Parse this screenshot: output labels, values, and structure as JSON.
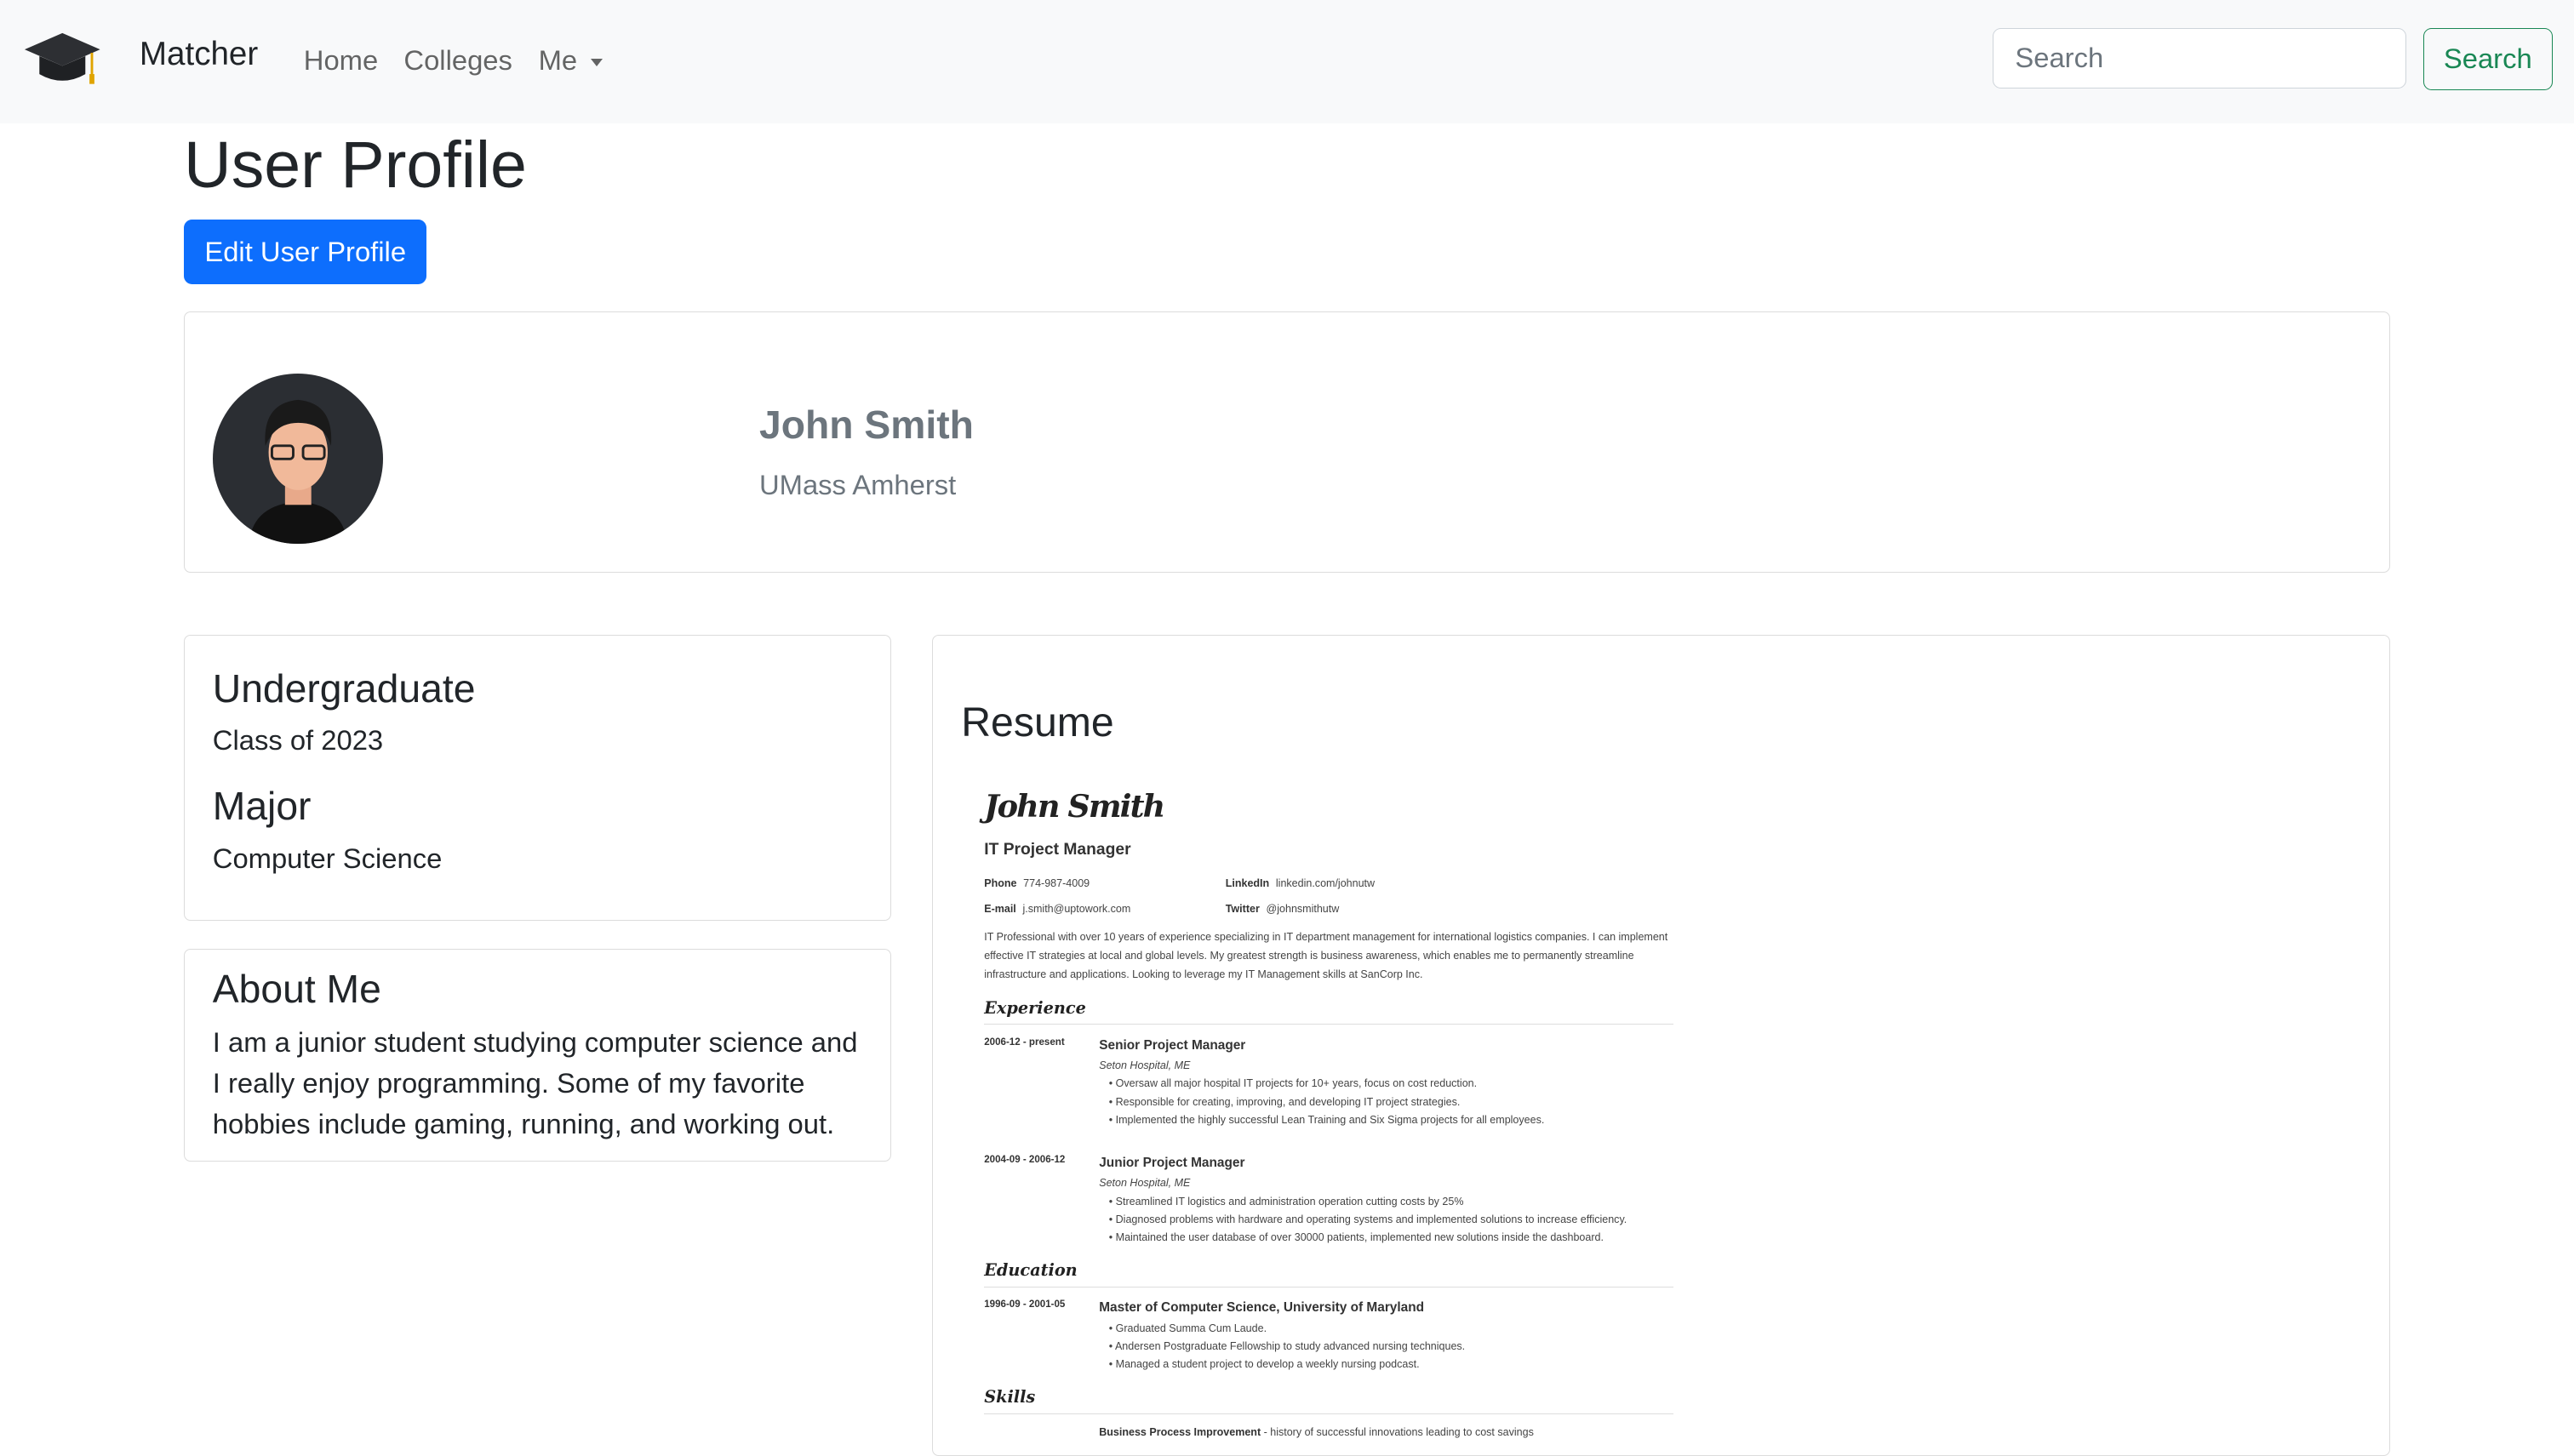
{
  "nav": {
    "brand": "Matcher",
    "links": [
      "Home",
      "Colleges",
      "Me"
    ],
    "search_placeholder": "Search",
    "search_button": "Search"
  },
  "page": {
    "title": "User Profile",
    "edit_button": "Edit User Profile"
  },
  "profile": {
    "name": "John Smith",
    "school": "UMass Amherst"
  },
  "academics": {
    "level": "Undergraduate",
    "class": "Class of 2023",
    "major_label": "Major",
    "major": "Computer Science"
  },
  "about": {
    "title": "About Me",
    "text": "I am a junior student studying computer science and I really enjoy programming. Some of my favorite hobbies include gaming, running, and working out."
  },
  "resume": {
    "heading": "Resume",
    "name": "John Smith",
    "title": "IT Project Manager",
    "phone_label": "Phone",
    "phone": "774-987-4009",
    "linkedin_label": "LinkedIn",
    "linkedin": "linkedin.com/johnutw",
    "email_label": "E-mail",
    "email": "j.smith@uptowork.com",
    "twitter_label": "Twitter",
    "twitter": "@johnsmithutw",
    "summary": "IT Professional with over 10 years of experience specializing in IT department management for international logistics companies. I can implement effective IT strategies at local and global levels. My greatest strength is business awareness, which enables me to permanently streamline infrastructure and applications. Looking to leverage my IT Management skills at SanCorp Inc.",
    "experience_label": "Experience",
    "jobs": [
      {
        "date": "2006-12 - present",
        "title": "Senior Project Manager",
        "place": "Seton Hospital, ME",
        "bullets": [
          "Oversaw all major hospital IT projects for 10+ years, focus on cost reduction.",
          "Responsible for creating, improving, and developing IT project strategies.",
          "Implemented the highly successful Lean Training and Six Sigma projects for all employees."
        ]
      },
      {
        "date": "2004-09 - 2006-12",
        "title": "Junior Project Manager",
        "place": "Seton Hospital, ME",
        "bullets": [
          "Streamlined IT logistics and administration operation cutting costs by 25%",
          "Diagnosed problems with hardware and operating systems and implemented solutions to increase efficiency.",
          "Maintained the user database of over 30000 patients, implemented new solutions inside the dashboard."
        ]
      }
    ],
    "education_label": "Education",
    "education": {
      "date": "1996-09 - 2001-05",
      "title": "Master of Computer Science, University of Maryland",
      "bullets": [
        "Graduated Summa Cum Laude.",
        "Andersen Postgraduate Fellowship to study advanced nursing techniques.",
        "Managed a student project to develop a weekly nursing podcast."
      ]
    },
    "skills_label": "Skills",
    "skill": {
      "name": "Business Process Improvement",
      "desc": " - history of successful innovations leading to cost savings"
    }
  }
}
